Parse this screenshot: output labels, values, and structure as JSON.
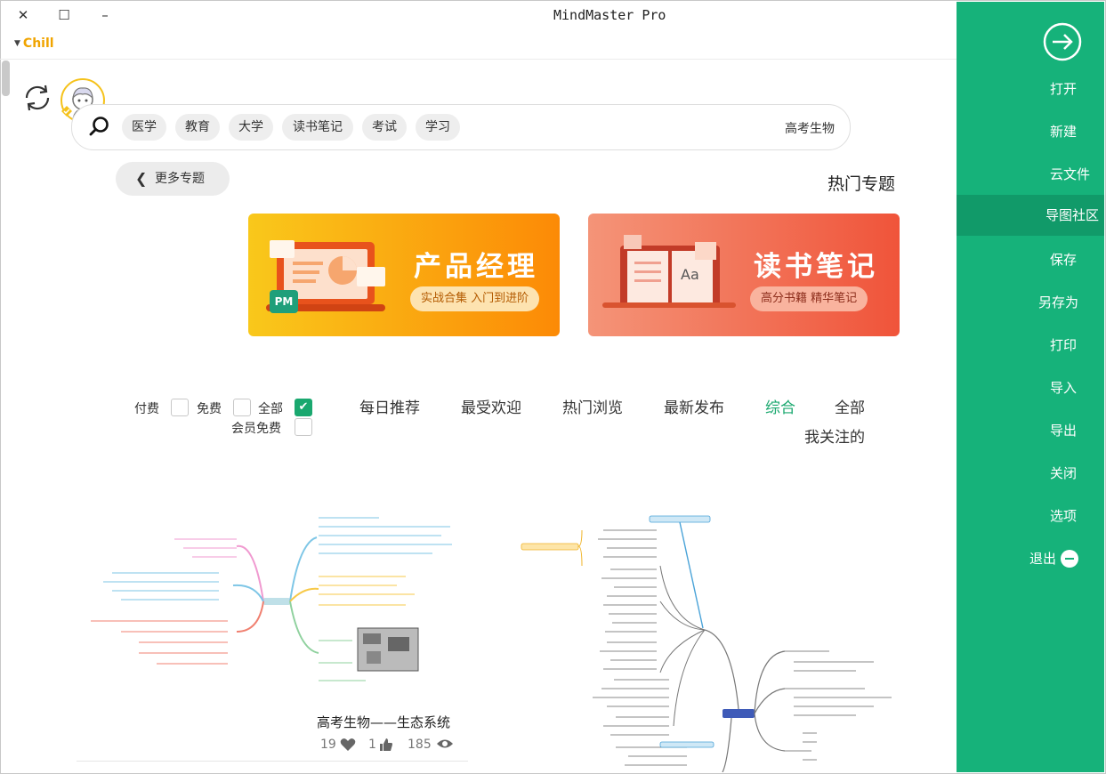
{
  "window": {
    "title": "MindMaster Pro",
    "close_glyph": "✕",
    "maximize_glyph": "☐",
    "minimize_glyph": "–"
  },
  "user": {
    "name": "Chill"
  },
  "search": {
    "placeholder": "高考生物",
    "tags": [
      "学习",
      "考试",
      "读书笔记",
      "大学",
      "教育",
      "医学"
    ]
  },
  "topics": {
    "title": "热门专题",
    "more_label": "更多专题",
    "banners": [
      {
        "title": "读书笔记",
        "subtitle": "高分书籍 精华笔记"
      },
      {
        "title": "产品经理",
        "subtitle": "实战合集 入门到进阶",
        "badge": "PM"
      }
    ]
  },
  "filters": {
    "tabs": [
      "全部",
      "综合",
      "最新发布",
      "热门浏览",
      "最受欢迎",
      "每日推荐",
      "我关注的"
    ],
    "active_tab": "综合",
    "price_options": [
      {
        "label": "全部",
        "checked": true
      },
      {
        "label": "免费",
        "checked": false
      },
      {
        "label": "付费",
        "checked": false
      },
      {
        "label": "会员免费",
        "checked": false
      }
    ]
  },
  "cards": [
    {
      "title": "高考生物——生态系统",
      "views": "185",
      "likes": "1",
      "favorites": "19"
    }
  ],
  "sidebar": {
    "items": [
      {
        "label": "打开"
      },
      {
        "label": "新建"
      },
      {
        "label": "云文件"
      },
      {
        "label": "导图社区",
        "active": true
      },
      {
        "label": "保存"
      },
      {
        "label": "另存为"
      },
      {
        "label": "打印"
      },
      {
        "label": "导入"
      },
      {
        "label": "导出"
      },
      {
        "label": "关闭"
      },
      {
        "label": "选项"
      },
      {
        "label": "退出"
      }
    ]
  },
  "colors": {
    "sidebar": "#16b27a",
    "sidebar_active": "#119a69",
    "accent": "#1aa86f",
    "user_name": "#f0a400",
    "banner_reading": "#f36f55",
    "banner_pm": "#fa9d12"
  }
}
